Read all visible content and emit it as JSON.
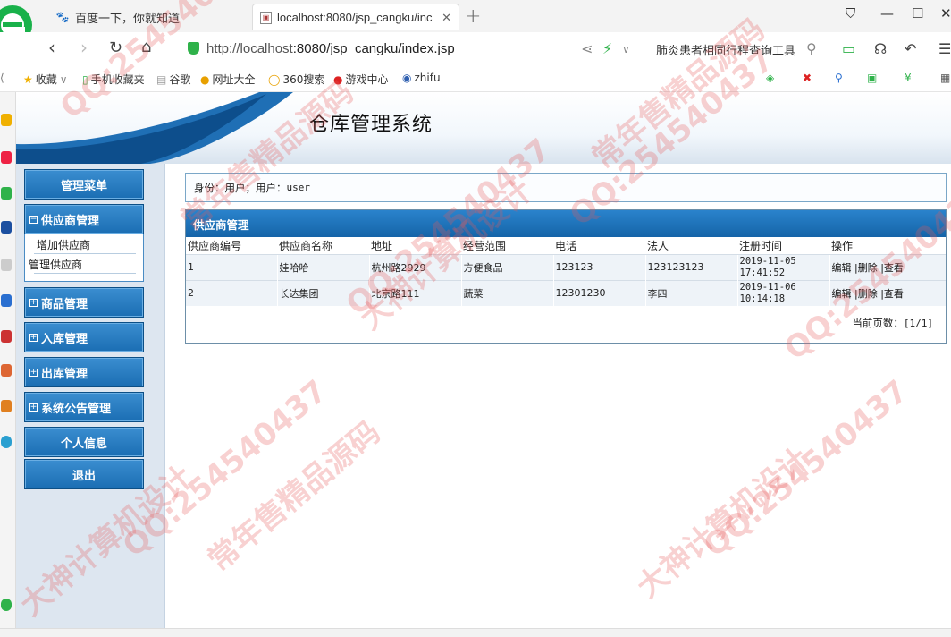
{
  "browser": {
    "tabs": [
      {
        "label": "百度一下，你就知道",
        "icon": "paw-icon"
      },
      {
        "label": "localhost:8080/jsp_cangku/inc",
        "icon": "page-icon"
      }
    ],
    "url": {
      "host": "http://localhost",
      "rest": ":8080/jsp_cangku/index.jsp"
    },
    "search_hint": "肺炎患者相同行程查询工具",
    "bookmarks": [
      {
        "label": "收藏",
        "icon": "star-icon"
      },
      {
        "label": "手机收藏夹",
        "icon": "phone-icon"
      },
      {
        "label": "谷歌",
        "icon": "doc-icon"
      },
      {
        "label": "网址大全",
        "icon": "globe-icon"
      },
      {
        "label": "360搜索",
        "icon": "search-icon"
      },
      {
        "label": "游戏中心",
        "icon": "game-icon"
      },
      {
        "label": "zhifu",
        "icon": "zhifu-icon"
      }
    ]
  },
  "app": {
    "title": "仓库管理系统",
    "sidebar": {
      "menu_title": "管理菜单",
      "groups": [
        {
          "label": "供应商管理",
          "expanded": true,
          "items": [
            "增加供应商",
            "管理供应商"
          ]
        },
        {
          "label": "商品管理"
        },
        {
          "label": "入库管理"
        },
        {
          "label": "出库管理"
        },
        {
          "label": "系统公告管理"
        }
      ],
      "personal_info": "个人信息",
      "logout": "退出"
    },
    "identity": {
      "prefix": "身份：用户；用户：",
      "user": "user"
    },
    "panel": {
      "title": "供应商管理",
      "columns": [
        "供应商编号",
        "供应商名称",
        "地址",
        "经营范围",
        "电话",
        "法人",
        "注册时间",
        "操作"
      ],
      "rows": [
        {
          "id": "1",
          "name": "娃哈哈",
          "address": "杭州路2929",
          "scope": "方便食品",
          "phone": "123123",
          "legal": "123123123",
          "date": "2019-11-05",
          "time": "17:41:52"
        },
        {
          "id": "2",
          "name": "长达集团",
          "address": "北京路111",
          "scope": "蔬菜",
          "phone": "12301230",
          "legal": "李四",
          "date": "2019-11-06",
          "time": "10:14:18"
        }
      ],
      "actions": {
        "edit": "编辑",
        "delete": "|删除",
        "view": "|查看"
      },
      "pager": {
        "label": "当前页数：",
        "value": "[1/1]"
      }
    }
  },
  "watermark": {
    "qq": "QQ:254540437",
    "phrase1": "常年售精品源码",
    "phrase2": "大神计算机设计"
  },
  "colors": {
    "menu_blue": "#1b6eb3",
    "panel_blue": "#1564a8",
    "sidebar_bg": "#dde6f0",
    "watermark": "#e65a5a"
  }
}
